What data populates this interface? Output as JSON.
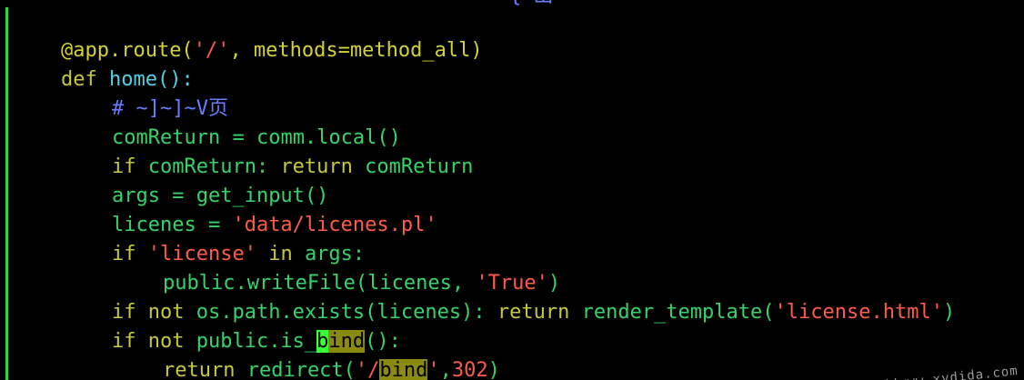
{
  "top_fragment": "{ 出",
  "code": {
    "line1": {
      "decorator": "@app.route(",
      "path": "'/'",
      "rest": ", methods=method_all)"
    },
    "line2": {
      "kw": "def",
      "space": " ",
      "fn": "home",
      "rest": "():"
    },
    "line3": {
      "comment": "# ~]~]~V页"
    },
    "line4": {
      "a": "comReturn",
      "b": " = ",
      "c": "comm.local",
      "d": "()"
    },
    "line5": {
      "kw1": "if",
      "a": " comReturn: ",
      "kw2": "return",
      "b": " comReturn"
    },
    "line6": {
      "a": "args",
      "b": " = ",
      "c": "get_input",
      "d": "()"
    },
    "line7": {
      "a": "licenes",
      "b": " = ",
      "str": "'data/licenes.pl'"
    },
    "line8": {
      "kw1": "if",
      "sp": " ",
      "str": "'license'",
      "kw2": " in ",
      "a": "args:"
    },
    "line9": {
      "a": "public.writeFile(licenes, ",
      "str": "'True'",
      "b": ")"
    },
    "line10": {
      "kw1": "if",
      "kw2": " not ",
      "a": "os.path.exists(licenes): ",
      "kw3": "return",
      "b": " render_template(",
      "str": "'license.html'",
      "c": ")"
    },
    "line11": {
      "kw1": "if",
      "kw2": " not ",
      "a": "public.is_",
      "cursor": "b",
      "match": "ind",
      "b": "():"
    },
    "line12": {
      "kw": "return",
      "a": " redirect(",
      "str1": "'/",
      "match": "bind",
      "str2": "'",
      "b": ",",
      "num": "302",
      "c": ")"
    }
  },
  "watermark": "https://www.xydida.com",
  "colors": {
    "background": "#000000",
    "gutter": "#2fd13a",
    "keyword": "#c8c83a",
    "function": "#52d1e6",
    "identifier": "#35d46a",
    "string": "#ff5a4a",
    "comment": "#6a7cff",
    "cursor_bg": "#3cff3c",
    "match_bg": "#8a8a10"
  }
}
